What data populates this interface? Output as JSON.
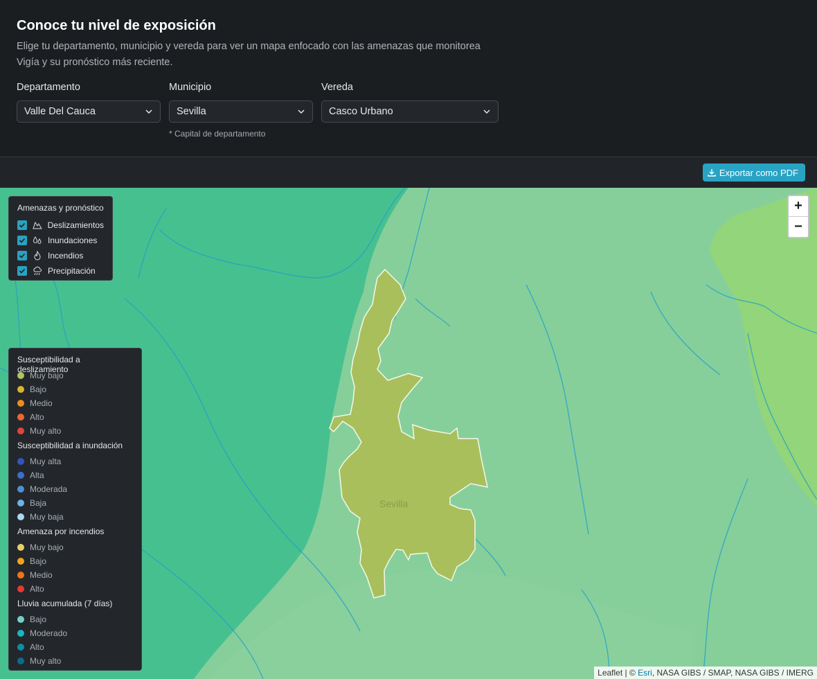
{
  "header": {
    "title": "Conoce tu nivel de exposición",
    "subtitle": "Elige tu departamento, municipio y vereda para ver un mapa enfocado con las amenazas que monitorea Vigía y su pronóstico más reciente.",
    "fields": {
      "departamento": {
        "label": "Departamento",
        "value": "Valle Del Cauca"
      },
      "municipio": {
        "label": "Municipio",
        "value": "Sevilla"
      },
      "vereda": {
        "label": "Vereda",
        "value": "Casco Urbano"
      }
    },
    "note": "* Capital de departamento"
  },
  "toolbar": {
    "export_label": "Exportar como PDF",
    "export_icon": "download-icon"
  },
  "map": {
    "region_label": "Sevilla",
    "zoom_in": "+",
    "zoom_out": "−",
    "attribution": {
      "prefix": "Leaflet | © ",
      "link": "Esri",
      "rest": ", NASA GIBS / SMAP, NASA GIBS / IMERG"
    },
    "colors": {
      "region_fill": "#a9bf5c",
      "dark_zone": "#47c08f",
      "light_zone": "#86cf9b",
      "right_zone": "#93d57a",
      "rivers": "#1f9fc9"
    }
  },
  "layers_panel": {
    "title": "Amenazas y pronóstico",
    "items": [
      {
        "label": "Deslizamientos",
        "icon": "landslide-icon",
        "checked": true
      },
      {
        "label": "Inundaciones",
        "icon": "water-drops-icon",
        "checked": true
      },
      {
        "label": "Incendios",
        "icon": "flame-icon",
        "checked": true
      },
      {
        "label": "Precipitación",
        "icon": "rain-cloud-icon",
        "checked": true
      }
    ]
  },
  "legend": {
    "groups": [
      {
        "title": "Susceptibilidad a deslizamiento",
        "items": [
          {
            "label": "Muy bajo",
            "color": "#b5c35b"
          },
          {
            "label": "Bajo",
            "color": "#d7b52a"
          },
          {
            "label": "Medio",
            "color": "#ee8d1c"
          },
          {
            "label": "Alto",
            "color": "#ea6734"
          },
          {
            "label": "Muy alto",
            "color": "#e0443f"
          }
        ]
      },
      {
        "title": "Susceptibilidad a inundación",
        "items": [
          {
            "label": "Muy alta",
            "color": "#3355bb"
          },
          {
            "label": "Alta",
            "color": "#3a70cc"
          },
          {
            "label": "Moderada",
            "color": "#4d8fd6"
          },
          {
            "label": "Baja",
            "color": "#6db2e5"
          },
          {
            "label": "Muy baja",
            "color": "#a8d8f2"
          }
        ]
      },
      {
        "title": "Amenaza por incendios",
        "items": [
          {
            "label": "Muy bajo",
            "color": "#e4cf6a"
          },
          {
            "label": "Bajo",
            "color": "#f0a41e"
          },
          {
            "label": "Medio",
            "color": "#f07418"
          },
          {
            "label": "Alto",
            "color": "#e13b2f"
          }
        ]
      },
      {
        "title": "Lluvia acumulada (7 días)",
        "items": [
          {
            "label": "Bajo",
            "color": "#73d0c8"
          },
          {
            "label": "Moderado",
            "color": "#1ab5c0"
          },
          {
            "label": "Alto",
            "color": "#0e8ea6"
          },
          {
            "label": "Muy alto",
            "color": "#0d6a8c"
          }
        ]
      }
    ]
  }
}
